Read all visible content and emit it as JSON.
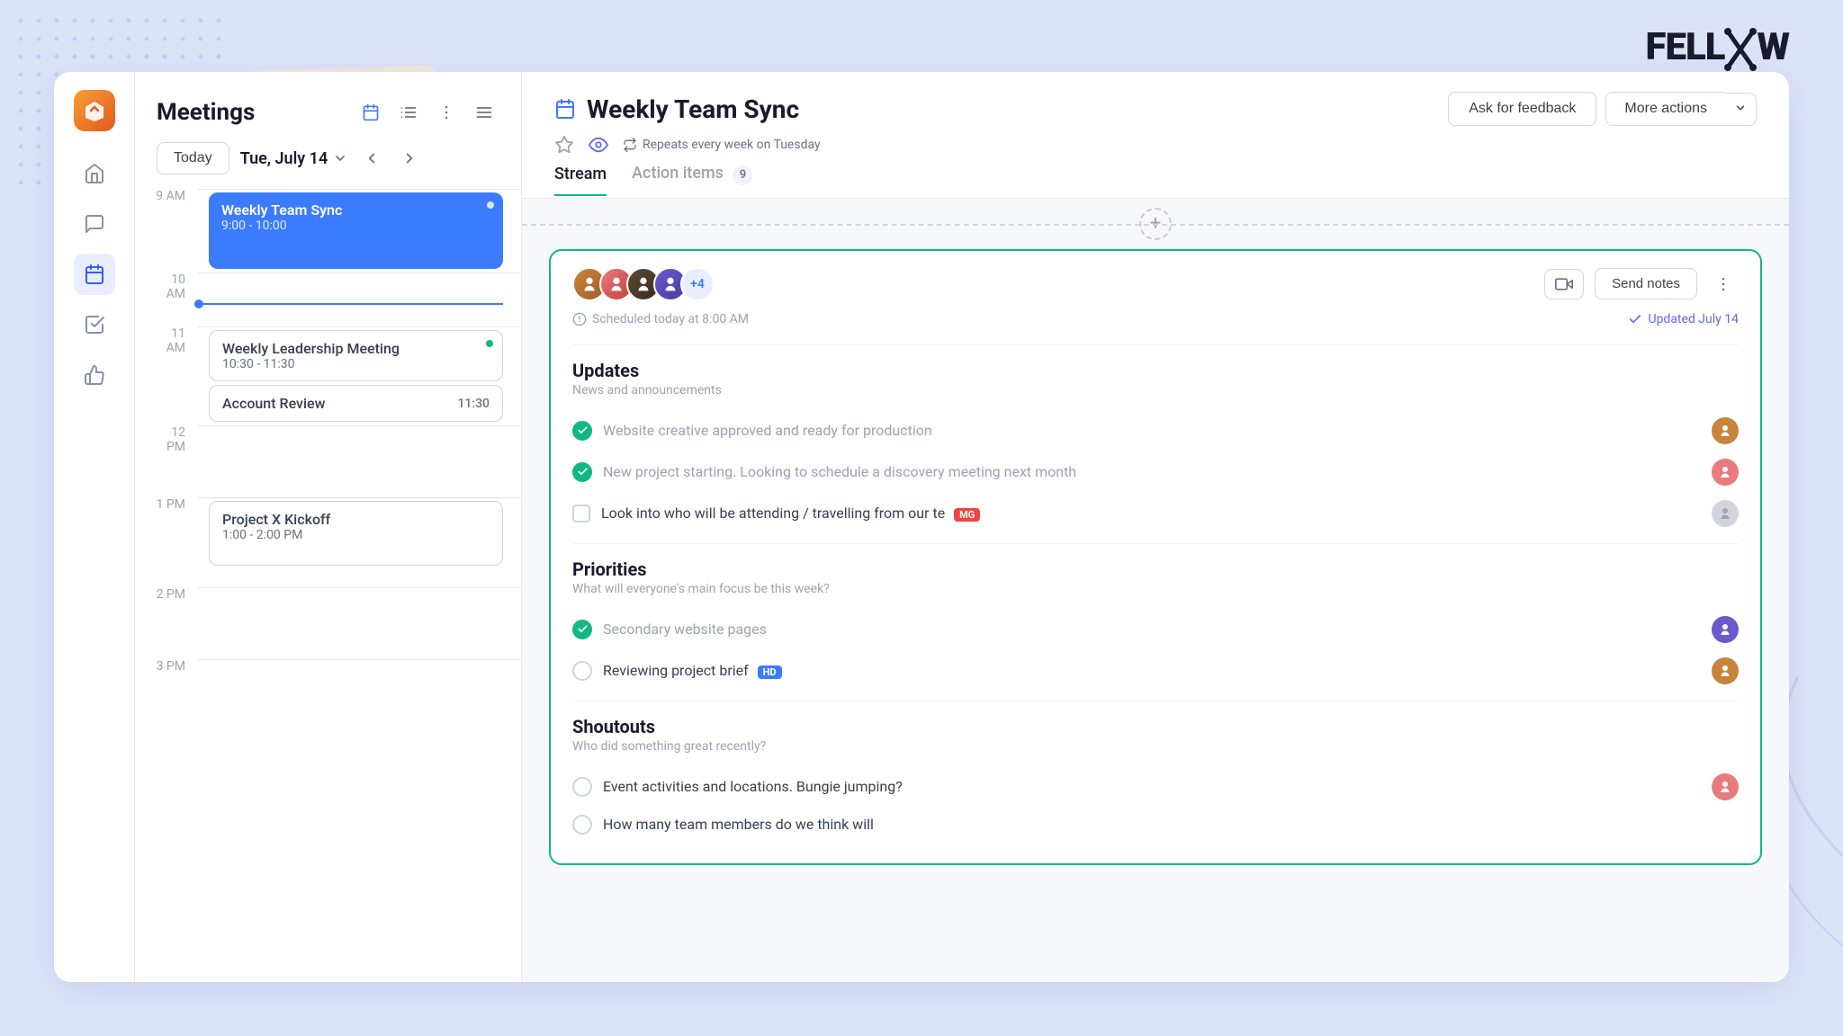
{
  "app": {
    "logo": "FELLOW",
    "logo_slash": "W"
  },
  "sidebar": {
    "items": [
      {
        "id": "home",
        "icon": "home-icon",
        "active": false
      },
      {
        "id": "notes",
        "icon": "notes-icon",
        "active": false
      },
      {
        "id": "calendar",
        "icon": "calendar-icon",
        "active": true
      },
      {
        "id": "tasks",
        "icon": "tasks-icon",
        "active": false
      },
      {
        "id": "thumbsup",
        "icon": "thumbsup-icon",
        "active": false
      }
    ]
  },
  "meetings_panel": {
    "title": "Meetings",
    "today_label": "Today",
    "date_display": "Tue, July 14",
    "time_slots": [
      {
        "label": "9 AM"
      },
      {
        "label": "10 AM"
      },
      {
        "label": "11 AM"
      },
      {
        "label": "12 PM"
      },
      {
        "label": "1 PM"
      },
      {
        "label": "2 PM"
      },
      {
        "label": "3 PM"
      }
    ],
    "events": [
      {
        "name": "Weekly Team Sync",
        "time": "9:00 - 10:00",
        "style": "blue",
        "slot": "9am"
      },
      {
        "name": "Weekly Leadership Meeting",
        "time": "10:30 - 11:30",
        "style": "outlined",
        "slot": "11am"
      },
      {
        "name": "Account Review",
        "time": "11:30",
        "style": "outlined",
        "slot": "11am"
      },
      {
        "name": "Project X Kickoff",
        "time": "1:00 - 2:00 PM",
        "style": "outlined",
        "slot": "1pm"
      }
    ]
  },
  "detail": {
    "title": "Weekly Team Sync",
    "repeat_text": "Repeats every week on Tuesday",
    "tabs": [
      {
        "label": "Stream",
        "active": true,
        "badge": null
      },
      {
        "label": "Action items",
        "active": false,
        "badge": "9"
      }
    ],
    "ask_feedback_label": "Ask for feedback",
    "more_actions_label": "More actions",
    "scheduled_text": "Scheduled today at 8:00 AM",
    "updated_text": "Updated July 14",
    "send_notes_label": "Send notes",
    "avatar_extra": "+4",
    "sections": [
      {
        "title": "Updates",
        "subtitle": "News and announcements",
        "items": [
          {
            "text": "Website creative approved and ready for production",
            "type": "checked",
            "badge": null
          },
          {
            "text": "New project starting. Looking to schedule a discovery meeting next month",
            "type": "checked",
            "badge": null
          },
          {
            "text": "Look into who will be attending / travelling from our te",
            "type": "checkbox",
            "badge": "MG"
          }
        ]
      },
      {
        "title": "Priorities",
        "subtitle": "What will everyone's main focus be this week?",
        "items": [
          {
            "text": "Secondary website pages",
            "type": "checked",
            "badge": null
          },
          {
            "text": "Reviewing project brief",
            "type": "unchecked",
            "badge": "HD"
          }
        ]
      },
      {
        "title": "Shoutouts",
        "subtitle": "Who did something great recently?",
        "items": [
          {
            "text": "Event activities and locations. Bungie jumping?",
            "type": "unchecked",
            "badge": null
          },
          {
            "text": "How many team members do we think will",
            "type": "unchecked",
            "badge": null
          }
        ]
      }
    ]
  }
}
